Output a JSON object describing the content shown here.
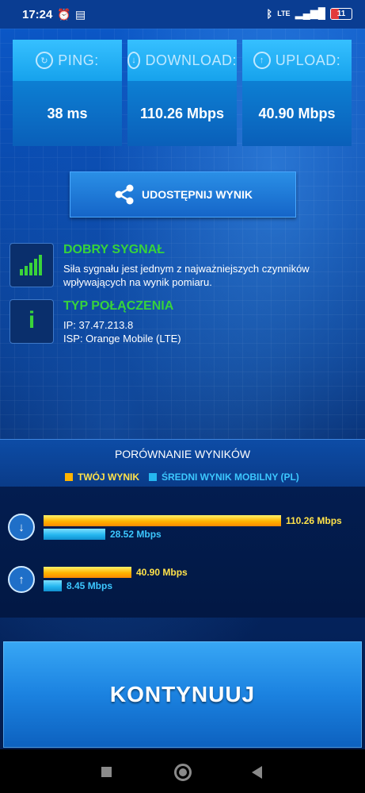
{
  "status_bar": {
    "time": "17:24",
    "network": "LTE",
    "battery": "11"
  },
  "metrics": {
    "ping": {
      "label": "PING:",
      "value": "38 ms"
    },
    "download": {
      "label": "DOWNLOAD:",
      "value": "110.26 Mbps"
    },
    "upload": {
      "label": "UPLOAD:",
      "value": "40.90 Mbps"
    }
  },
  "share_button": {
    "label": "UDOSTĘPNIJ WYNIK"
  },
  "signal": {
    "title": "DOBRY SYGNAŁ",
    "text": "Siła sygnału jest jednym z najważniejszych czynników wpływających na wynik pomiaru."
  },
  "connection": {
    "title": "TYP POŁĄCZENIA",
    "ip": "IP: 37.47.213.8",
    "isp": "ISP: Orange Mobile (LTE)",
    "icon_glyph": "i"
  },
  "comparison": {
    "title": "PORÓWNANIE WYNIKÓW",
    "legend_you": "TWÓJ WYNIK",
    "legend_avg": "ŚREDNI WYNIK MOBILNY (PL)",
    "colors": {
      "you": "#ffb300",
      "avg": "#25b7f0"
    }
  },
  "chart_data": {
    "type": "bar",
    "categories": [
      "Download",
      "Upload"
    ],
    "series": [
      {
        "name": "TWÓJ WYNIK",
        "values": [
          110.26,
          40.9
        ],
        "labels": [
          "110.26 Mbps",
          "40.90 Mbps"
        ]
      },
      {
        "name": "ŚREDNI WYNIK MOBILNY (PL)",
        "values": [
          28.52,
          8.45
        ],
        "labels": [
          "28.52 Mbps",
          "8.45 Mbps"
        ]
      }
    ],
    "xlim": [
      0,
      110.26
    ]
  },
  "continue_button": {
    "label": "KONTYNUUJ"
  }
}
